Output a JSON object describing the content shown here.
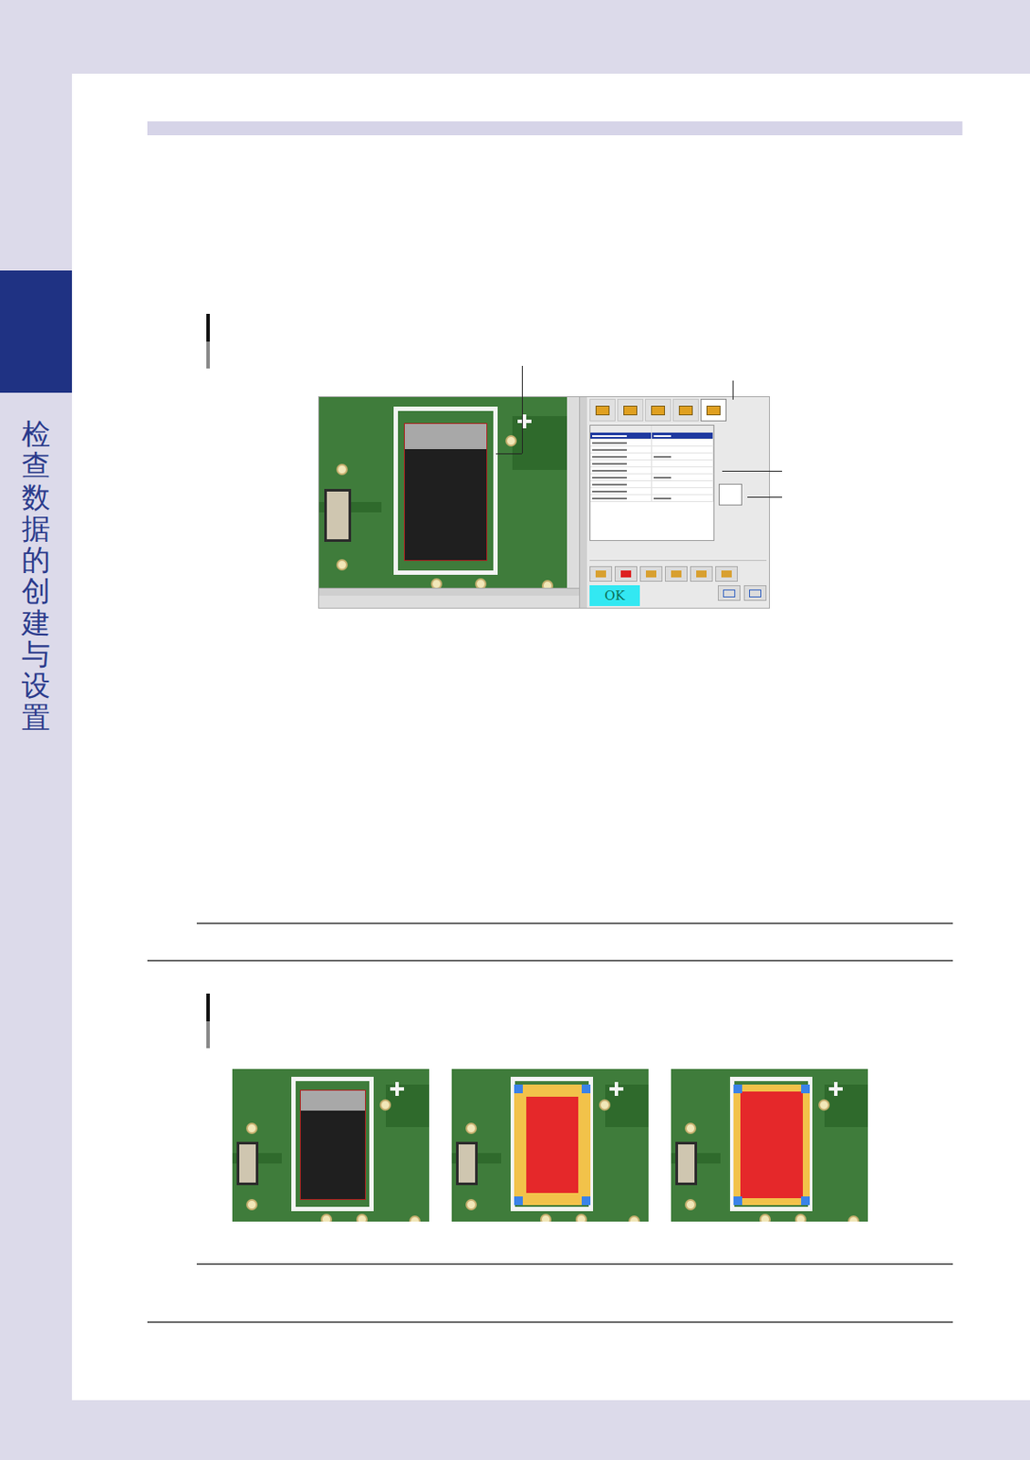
{
  "sidebar": {
    "title": "检查数据的创建与设置"
  },
  "figure1": {
    "panel": {
      "tabs": [
        {
          "selected": false
        },
        {
          "selected": false
        },
        {
          "selected": false
        },
        {
          "selected": false
        },
        {
          "selected": true
        }
      ],
      "rows": [
        {
          "selected": true
        },
        {
          "selected": false
        },
        {
          "selected": false
        },
        {
          "selected": false
        },
        {
          "selected": false
        },
        {
          "selected": false
        },
        {
          "selected": false
        },
        {
          "selected": false
        },
        {
          "selected": false
        },
        {
          "selected": false
        }
      ],
      "result": "OK"
    }
  },
  "figure2": {
    "images": [
      {
        "kind": "plain"
      },
      {
        "kind": "overlay"
      },
      {
        "kind": "filled"
      }
    ]
  }
}
